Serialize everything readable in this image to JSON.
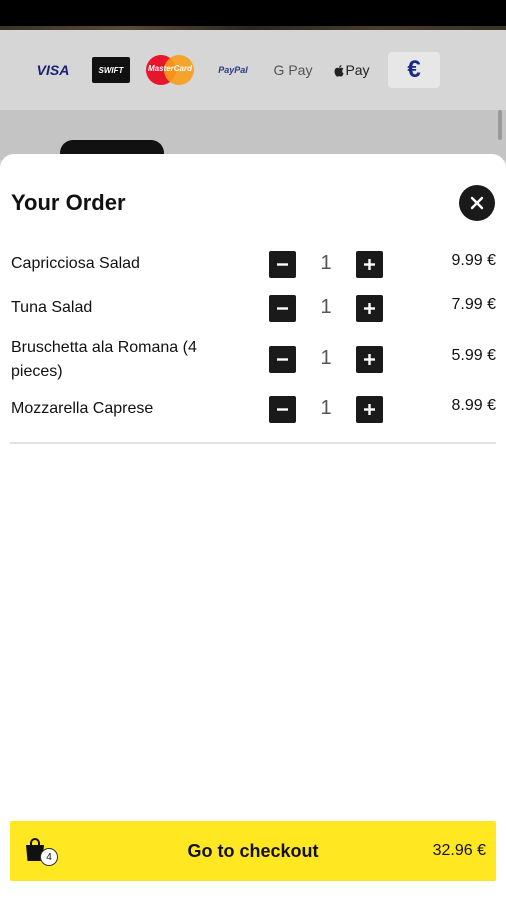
{
  "payment_methods": [
    "VISA",
    "SWIFT",
    "MasterCard",
    "PayPal",
    "G Pay",
    "Pay",
    "€"
  ],
  "order": {
    "title": "Your Order",
    "items": [
      {
        "name": "Capricciosa Salad",
        "qty": "1",
        "price": "9.99 €"
      },
      {
        "name": "Tuna Salad",
        "qty": "1",
        "price": "7.99 €"
      },
      {
        "name": "Bruschetta ala Romana (4 pieces)",
        "qty": "1",
        "price": "5.99 €"
      },
      {
        "name": "Mozzarella Caprese",
        "qty": "1",
        "price": "8.99 €"
      }
    ]
  },
  "checkout": {
    "label": "Go to checkout",
    "total": "32.96 €",
    "cart_count": "4"
  },
  "colors": {
    "accent": "#ffe822",
    "button_dark": "#1a1a1a"
  },
  "icons": {
    "close": "close-icon",
    "minus": "minus-icon",
    "plus": "plus-icon",
    "bag": "shopping-bag-icon"
  }
}
